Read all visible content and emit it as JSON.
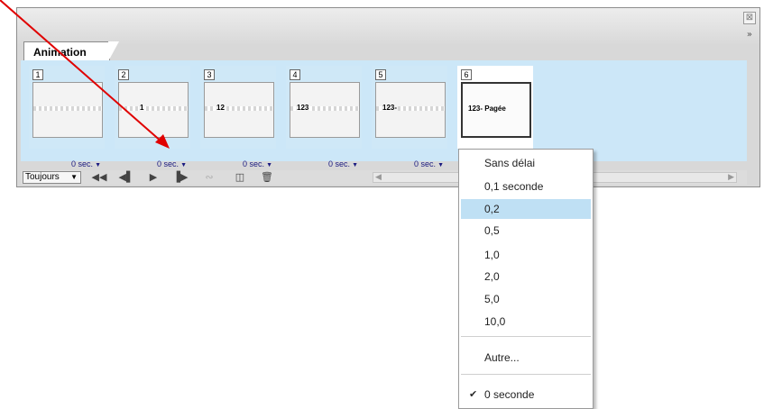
{
  "panel": {
    "tab_label": "Animation",
    "close_glyph": "⊠",
    "menu_glyph": "»"
  },
  "frames": [
    {
      "number": "1",
      "thumb_text": "",
      "delay": "0 sec."
    },
    {
      "number": "2",
      "thumb_text": "1",
      "delay": "0 sec."
    },
    {
      "number": "3",
      "thumb_text": "12",
      "delay": "0 sec."
    },
    {
      "number": "4",
      "thumb_text": "123",
      "delay": "0 sec."
    },
    {
      "number": "5",
      "thumb_text": "123-",
      "delay": "0 sec."
    },
    {
      "number": "6",
      "thumb_text": "123- Pagée",
      "delay": ""
    }
  ],
  "toolbar": {
    "loop_value": "Toujours",
    "icons": [
      "first-frame-icon",
      "previous-frame-icon",
      "play-icon",
      "next-frame-icon",
      "tween-icon",
      "duplicate-frame-icon",
      "delete-frame-icon"
    ]
  },
  "delay_menu": {
    "items": [
      "Sans délai",
      "0,1 seconde",
      "0,2",
      "0,5",
      "1,0",
      "2,0",
      "5,0",
      "10,0"
    ],
    "other": "Autre...",
    "checked_item": "0 seconde",
    "highlighted": "0,2"
  },
  "colors": {
    "frame_strip": "#cce7f8",
    "menu_highlight": "#bfe0f4",
    "delay_text": "#1a1a80",
    "annotation_arrow": "#e00000"
  }
}
